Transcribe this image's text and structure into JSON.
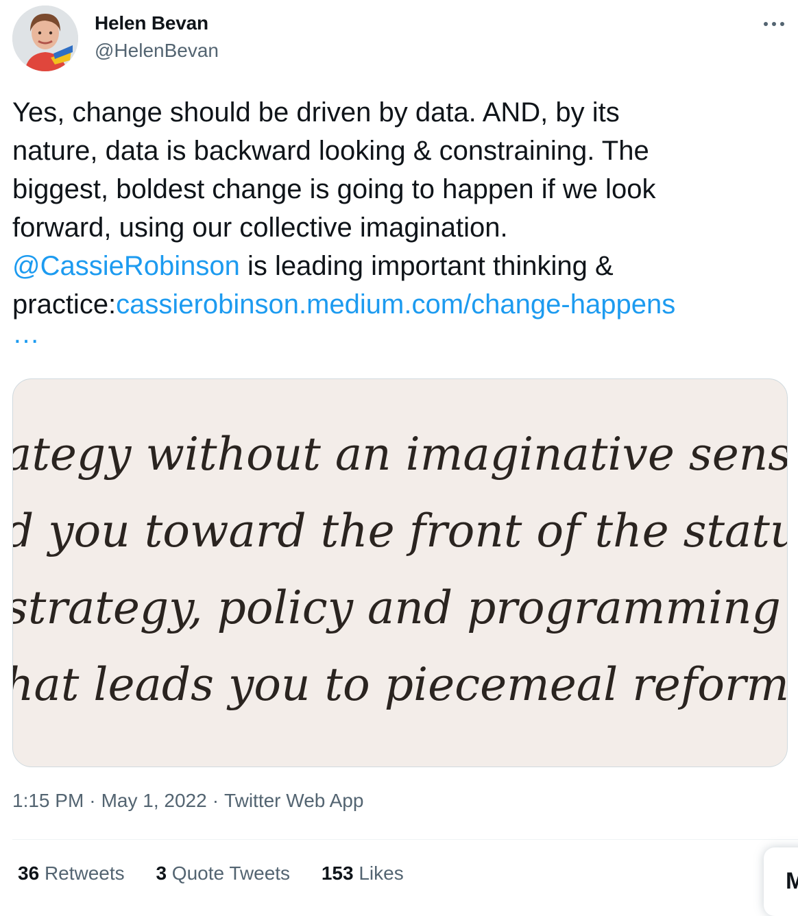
{
  "author": {
    "name": "Helen Bevan",
    "handle": "@HelenBevan"
  },
  "tweet": {
    "line1": "Yes, change should be driven by data. AND, by its",
    "line2": "nature, data is backward looking & constraining. The",
    "line3": "biggest, boldest change is going to happen if we look",
    "line4": "forward, using our collective imagination.",
    "mention": "@CassieRobinson",
    "line5_rest": " is leading important thinking &",
    "line6_prefix": "practice:",
    "url": "cassierobinson.medium.com/change-happens",
    "ellipsis": "…"
  },
  "media": {
    "quote_lines": [
      "ategy without an imaginative sense of wh",
      "d you toward the front of the status quo,",
      "strategy, policy and programming and l",
      "hat leads you to piecemeal reform.” — A"
    ]
  },
  "meta": {
    "time": "1:15 PM",
    "separator": "·",
    "date": "May 1, 2022",
    "source": "Twitter Web App"
  },
  "stats": {
    "retweets_count": "36",
    "retweets_label": "Retweets",
    "quotes_count": "3",
    "quotes_label": "Quote Tweets",
    "likes_count": "153",
    "likes_label": "Likes"
  },
  "popup": {
    "partial_text": "M"
  },
  "colors": {
    "link": "#1d9bf0",
    "text": "#0f1419",
    "secondary": "#536471",
    "media_bg": "#f3ede9"
  }
}
